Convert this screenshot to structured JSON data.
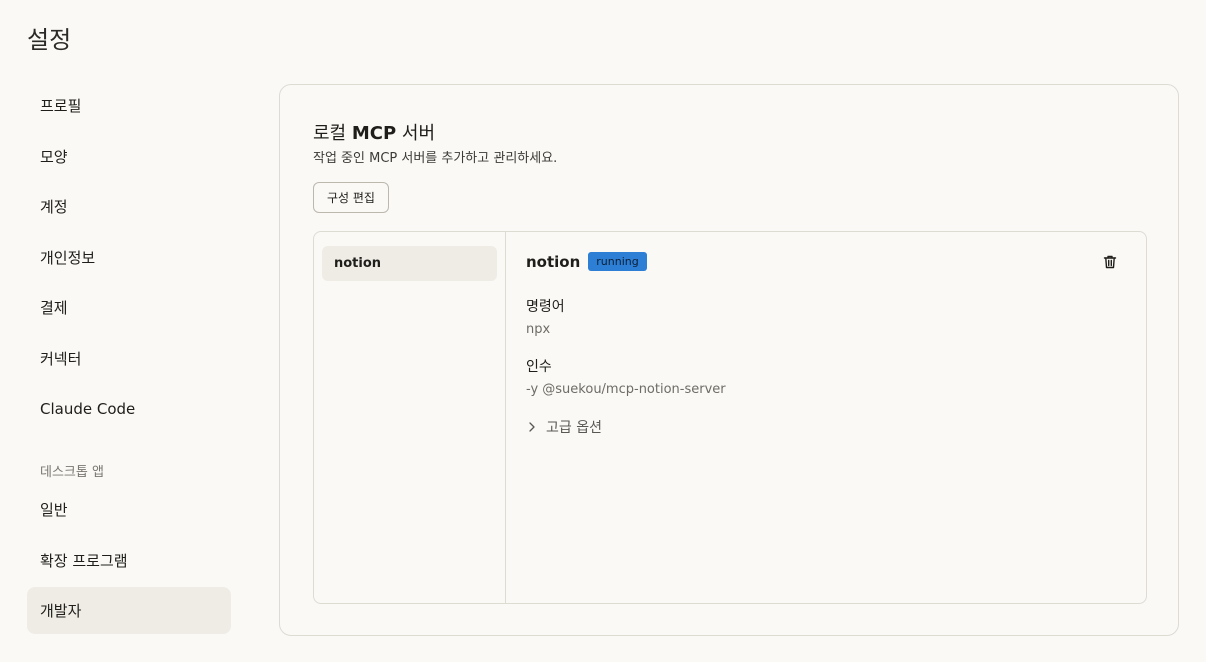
{
  "page": {
    "title": "설정"
  },
  "sidebar": {
    "items": [
      {
        "label": "프로필"
      },
      {
        "label": "모양"
      },
      {
        "label": "계정"
      },
      {
        "label": "개인정보"
      },
      {
        "label": "결제"
      },
      {
        "label": "커넥터"
      },
      {
        "label": "Claude Code"
      }
    ],
    "section_label": "데스크톱 앱",
    "desktop_items": [
      {
        "label": "일반"
      },
      {
        "label": "확장 프로그램"
      },
      {
        "label": "개발자",
        "active": true
      }
    ]
  },
  "mcp": {
    "title_prefix": "로컬 ",
    "title_bold": "MCP",
    "title_suffix": " 서버",
    "description": "작업 중인 MCP 서버를 추가하고 관리하세요.",
    "edit_config_label": "구성 편집",
    "servers": [
      {
        "name": "notion",
        "selected": true
      }
    ],
    "selected": {
      "name": "notion",
      "status": "running",
      "command_label": "명령어",
      "command_value": "npx",
      "args_label": "인수",
      "args_value": "-y @suekou/mcp-notion-server",
      "advanced_label": "고급 옵션"
    }
  },
  "colors": {
    "badge_bg": "#2d7fd6",
    "active_bg": "#efece5",
    "page_bg": "#faf9f6"
  }
}
